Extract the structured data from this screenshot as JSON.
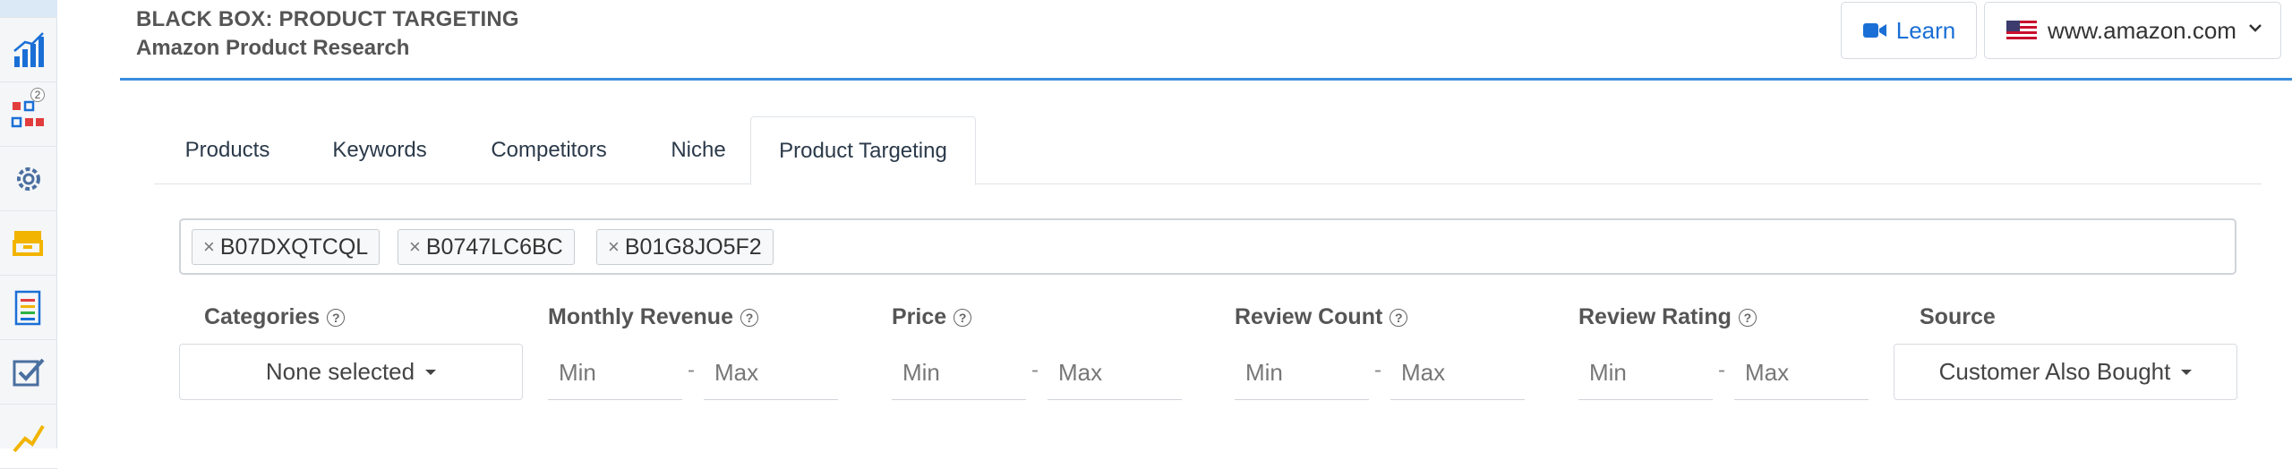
{
  "sidebar": {
    "icons": [
      {
        "name": "box-icon"
      },
      {
        "name": "bar-chart-icon"
      },
      {
        "name": "grid-compare-icon",
        "badge": "2"
      },
      {
        "name": "gear-icon"
      },
      {
        "name": "drawer-icon"
      },
      {
        "name": "list-document-icon"
      },
      {
        "name": "checkbox-icon"
      },
      {
        "name": "trend-icon"
      }
    ]
  },
  "header": {
    "title": "BLACK BOX: PRODUCT TARGETING",
    "subtitle": "Amazon Product Research",
    "learn_label": "Learn",
    "marketplace": "www.amazon.com"
  },
  "tabs": [
    {
      "label": "Products"
    },
    {
      "label": "Keywords"
    },
    {
      "label": "Competitors"
    },
    {
      "label": "Niche"
    },
    {
      "label": "Product Targeting"
    }
  ],
  "asins": [
    "B07DXQTCQL",
    "B0747LC6BC",
    "B01G8JO5F2"
  ],
  "filters": {
    "categories": {
      "label": "Categories",
      "value": "None selected"
    },
    "monthly_revenue": {
      "label": "Monthly Revenue",
      "min_placeholder": "Min",
      "max_placeholder": "Max"
    },
    "price": {
      "label": "Price",
      "min_placeholder": "Min",
      "max_placeholder": "Max"
    },
    "review_count": {
      "label": "Review Count",
      "min_placeholder": "Min",
      "max_placeholder": "Max"
    },
    "review_rating": {
      "label": "Review Rating",
      "min_placeholder": "Min",
      "max_placeholder": "Max"
    },
    "source": {
      "label": "Source",
      "value": "Customer Also Bought"
    }
  },
  "colors": {
    "accent": "#3a8dde",
    "link": "#1a6fd6"
  }
}
